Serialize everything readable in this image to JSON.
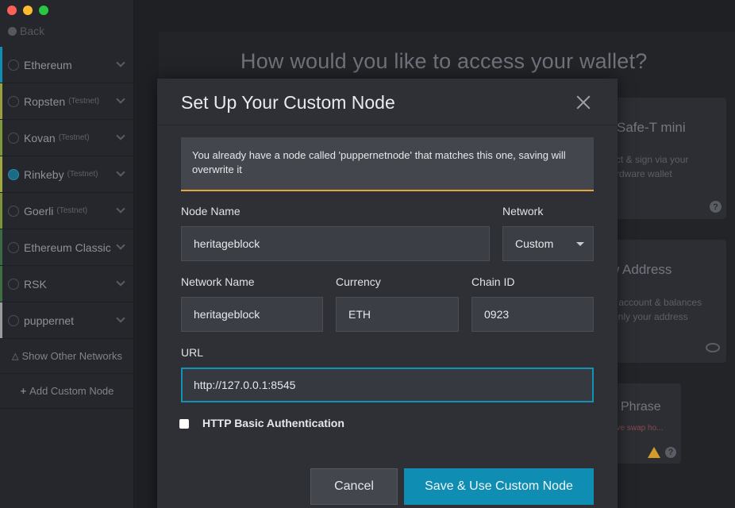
{
  "sidebar": {
    "back_label": "Back",
    "networks": [
      {
        "name": "Ethereum",
        "tag": "",
        "color": "#0f8db2",
        "selected": false
      },
      {
        "name": "Ropsten",
        "tag": "(Testnet)",
        "color": "#9aa03d",
        "selected": false
      },
      {
        "name": "Kovan",
        "tag": "(Testnet)",
        "color": "#7e9a3a",
        "selected": false
      },
      {
        "name": "Rinkeby",
        "tag": "(Testnet)",
        "color": "#9fa93e",
        "selected": true
      },
      {
        "name": "Goerli",
        "tag": "(Testnet)",
        "color": "#7c9437",
        "selected": false
      },
      {
        "name": "Ethereum Classic",
        "tag": "",
        "color": "#3a6b46",
        "selected": false
      },
      {
        "name": "RSK",
        "tag": "",
        "color": "#3d6e44",
        "selected": false
      },
      {
        "name": "puppernet",
        "tag": "",
        "color": "#9b9b9b",
        "selected": false
      }
    ],
    "show_other_label": "Show Other Networks",
    "add_custom_label": "Add Custom Node"
  },
  "background": {
    "title": "How would you like to access your wallet?",
    "cards": {
      "safe_t": {
        "title": "Safe-T mini",
        "desc1": "ct & sign via your",
        "desc2": "rdware wallet"
      },
      "view": {
        "title": "w Address",
        "desc1": "r account & balances",
        "desc2": "only your address"
      },
      "phrase": {
        "title": "Phrase",
        "warning": "ave swap ho..."
      }
    }
  },
  "modal": {
    "title": "Set Up Your Custom Node",
    "warning": "You already have a node called 'puppernetnode' that matches this one, saving will overwrite it",
    "node_name_label": "Node Name",
    "node_name_value": "heritageblock",
    "network_label": "Network",
    "network_value": "Custom",
    "network_name_label": "Network Name",
    "network_name_value": "heritageblock",
    "currency_label": "Currency",
    "currency_value": "ETH",
    "chain_id_label": "Chain ID",
    "chain_id_value": "0923",
    "url_label": "URL",
    "url_value": "http://127.0.0.1:8545",
    "http_auth_label": "HTTP Basic Authentication",
    "http_auth_checked": false,
    "cancel_label": "Cancel",
    "save_label": "Save & Use Custom Node"
  },
  "colors": {
    "accent": "#0f8db2",
    "warning_border": "#e8a33a"
  }
}
